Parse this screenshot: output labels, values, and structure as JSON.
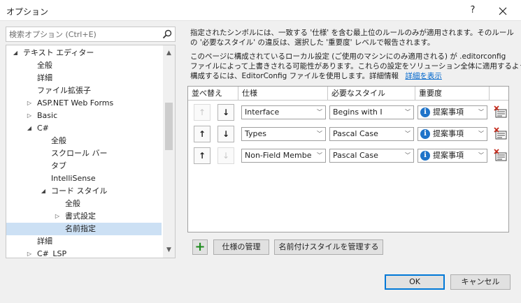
{
  "window": {
    "title": "オプション",
    "help_label": "?"
  },
  "search": {
    "placeholder": "検索オプション (Ctrl+E)"
  },
  "tree": {
    "items": [
      {
        "label": "テキスト エディター",
        "expander": "◢"
      },
      {
        "label": "全般"
      },
      {
        "label": "詳細"
      },
      {
        "label": "ファイル拡張子"
      },
      {
        "label": "ASP.NET Web Forms",
        "expander": "▷"
      },
      {
        "label": "Basic",
        "expander": "▷"
      },
      {
        "label": "C#",
        "expander": "◢"
      },
      {
        "label": "全般"
      },
      {
        "label": "スクロール バー"
      },
      {
        "label": "タブ"
      },
      {
        "label": "IntelliSense"
      },
      {
        "label": "コード スタイル",
        "expander": "◢"
      },
      {
        "label": "全般"
      },
      {
        "label": "書式設定",
        "expander": "▷"
      },
      {
        "label": "名前指定",
        "selected": true
      },
      {
        "label": "詳細"
      },
      {
        "label": "C#_LSP",
        "expander": "▷"
      }
    ]
  },
  "description": {
    "line1": "指定されたシンボルには、一致する '仕様' を含む最上位のルールのみが適用されます。そのルール",
    "line2": "の '必要なスタイル' の違反は、選択した '重要度' レベルで報告されます。",
    "line3": "このページに構成されているローカル設定 (ご使用のマシンにのみ適用される) が .editorconfig",
    "line4": "ファイルによって上書きされる可能性があります。これらの設定をソリューション全体に適用するよう",
    "line5": "構成するには、EditorConfig ファイルを使用します。詳細情報",
    "link": "詳細を表示"
  },
  "grid": {
    "headers": {
      "reorder": "並べ替え",
      "spec": "仕様",
      "style": "必要なスタイル",
      "severity": "重要度"
    },
    "rows": [
      {
        "up_enabled": false,
        "down_enabled": true,
        "spec": "Interface",
        "style": "Begins with I",
        "severity": "提案事項"
      },
      {
        "up_enabled": true,
        "down_enabled": true,
        "spec": "Types",
        "style": "Pascal Case",
        "severity": "提案事項"
      },
      {
        "up_enabled": true,
        "down_enabled": false,
        "spec": "Non-Field Membe",
        "style": "Pascal Case",
        "severity": "提案事項"
      }
    ]
  },
  "buttons": {
    "add": "+",
    "manage_specs": "仕様の管理",
    "manage_naming_styles": "名前付けスタイルを管理する",
    "ok": "OK",
    "cancel": "キャンセル"
  },
  "icons": {
    "close": "close-icon",
    "search": "search-icon",
    "move_up": "arrow-up-icon",
    "move_down": "arrow-down-icon",
    "info": "info-icon",
    "delete": "delete-icon",
    "add": "plus-icon"
  },
  "colors": {
    "accent": "#0078d7",
    "selection": "#cce0f4",
    "link": "#0066cc",
    "info": "#1e73c9",
    "delete": "#c42b1c",
    "add": "#1b8a1b"
  }
}
